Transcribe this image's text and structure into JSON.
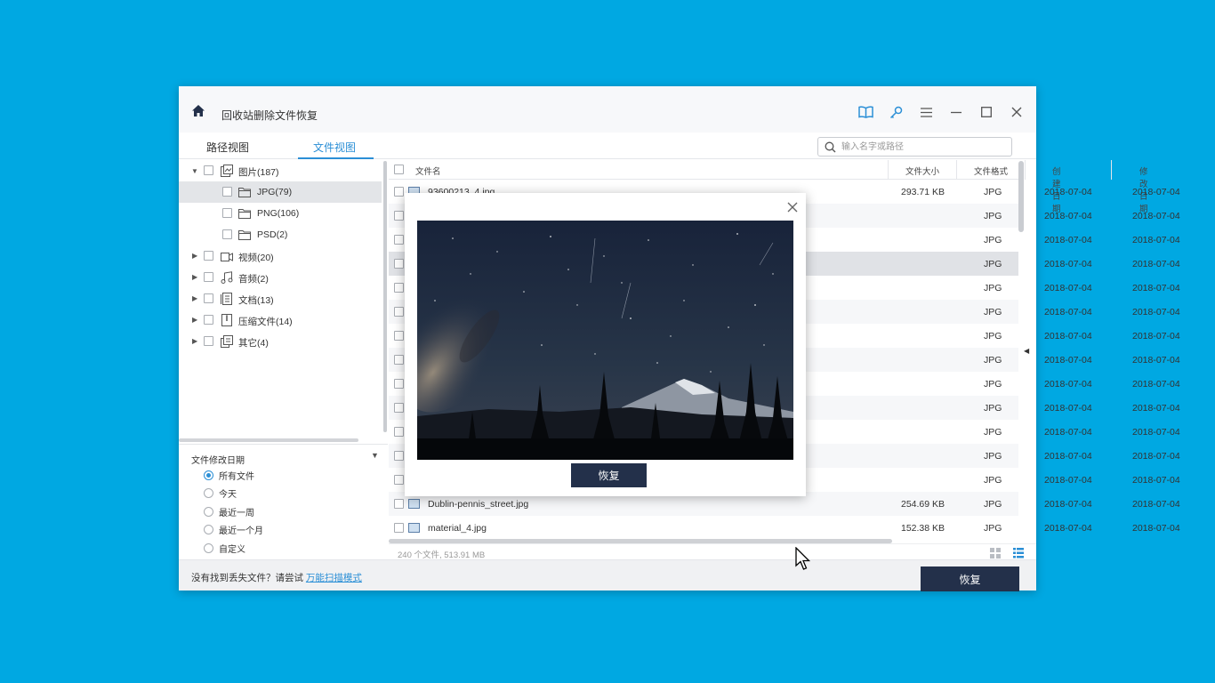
{
  "window": {
    "title": "回收站删除文件恢复"
  },
  "titlebar_icons": [
    "book-icon",
    "key-icon",
    "menu-icon",
    "minimize-icon",
    "maximize-icon",
    "close-icon"
  ],
  "tabs": [
    {
      "label": "路径视图",
      "active": false
    },
    {
      "label": "文件视图",
      "active": true
    }
  ],
  "search": {
    "placeholder": "输入名字或路径"
  },
  "tree": [
    {
      "label": "图片(187)",
      "expanded": true
    },
    {
      "label": "JPG(79)",
      "selected": true
    },
    {
      "label": "PNG(106)"
    },
    {
      "label": "PSD(2)"
    },
    {
      "label": "视频(20)"
    },
    {
      "label": "音频(2)"
    },
    {
      "label": "文档(13)"
    },
    {
      "label": "压缩文件(14)"
    },
    {
      "label": "其它(4)"
    }
  ],
  "filter": {
    "title": "文件修改日期",
    "options": [
      "所有文件",
      "今天",
      "最近一周",
      "最近一个月",
      "自定义"
    ],
    "selected": "所有文件"
  },
  "columns": {
    "name": "文件名",
    "size": "文件大小",
    "format": "文件格式",
    "created": "创建日期",
    "modified": "修改日期"
  },
  "rows": [
    {
      "name": "93600213_4.jpg",
      "size": "293.71 KB",
      "format": "JPG",
      "created": "2018-07-04",
      "modified": "2018-07-04"
    },
    {
      "name": "",
      "size": "",
      "format": "JPG",
      "created": "2018-07-04",
      "modified": "2018-07-04"
    },
    {
      "name": "",
      "size": "",
      "format": "JPG",
      "created": "2018-07-04",
      "modified": "2018-07-04"
    },
    {
      "name": "",
      "size": "",
      "format": "JPG",
      "created": "2018-07-04",
      "modified": "2018-07-04"
    },
    {
      "name": "",
      "size": "",
      "format": "JPG",
      "created": "2018-07-04",
      "modified": "2018-07-04"
    },
    {
      "name": "",
      "size": "",
      "format": "JPG",
      "created": "2018-07-04",
      "modified": "2018-07-04"
    },
    {
      "name": "",
      "size": "",
      "format": "JPG",
      "created": "2018-07-04",
      "modified": "2018-07-04"
    },
    {
      "name": "",
      "size": "",
      "format": "JPG",
      "created": "2018-07-04",
      "modified": "2018-07-04"
    },
    {
      "name": "",
      "size": "",
      "format": "JPG",
      "created": "2018-07-04",
      "modified": "2018-07-04"
    },
    {
      "name": "",
      "size": "",
      "format": "JPG",
      "created": "2018-07-04",
      "modified": "2018-07-04"
    },
    {
      "name": "",
      "size": "",
      "format": "JPG",
      "created": "2018-07-04",
      "modified": "2018-07-04"
    },
    {
      "name": "",
      "size": "",
      "format": "JPG",
      "created": "2018-07-04",
      "modified": "2018-07-04"
    },
    {
      "name": "",
      "size": "",
      "format": "JPG",
      "created": "2018-07-04",
      "modified": "2018-07-04"
    },
    {
      "name": "Dublin-pennis_street.jpg",
      "size": "254.69 KB",
      "format": "JPG",
      "created": "2018-07-04",
      "modified": "2018-07-04"
    },
    {
      "name": "material_4.jpg",
      "size": "152.38 KB",
      "format": "JPG",
      "created": "2018-07-04",
      "modified": "2018-07-04"
    }
  ],
  "status": {
    "summary": "240 个文件, 513.91 MB"
  },
  "footer": {
    "hint": "没有找到丢失文件？请尝试",
    "link": "万能扫描模式",
    "recover_label": "恢复"
  },
  "preview": {
    "recover_label": "恢复"
  }
}
